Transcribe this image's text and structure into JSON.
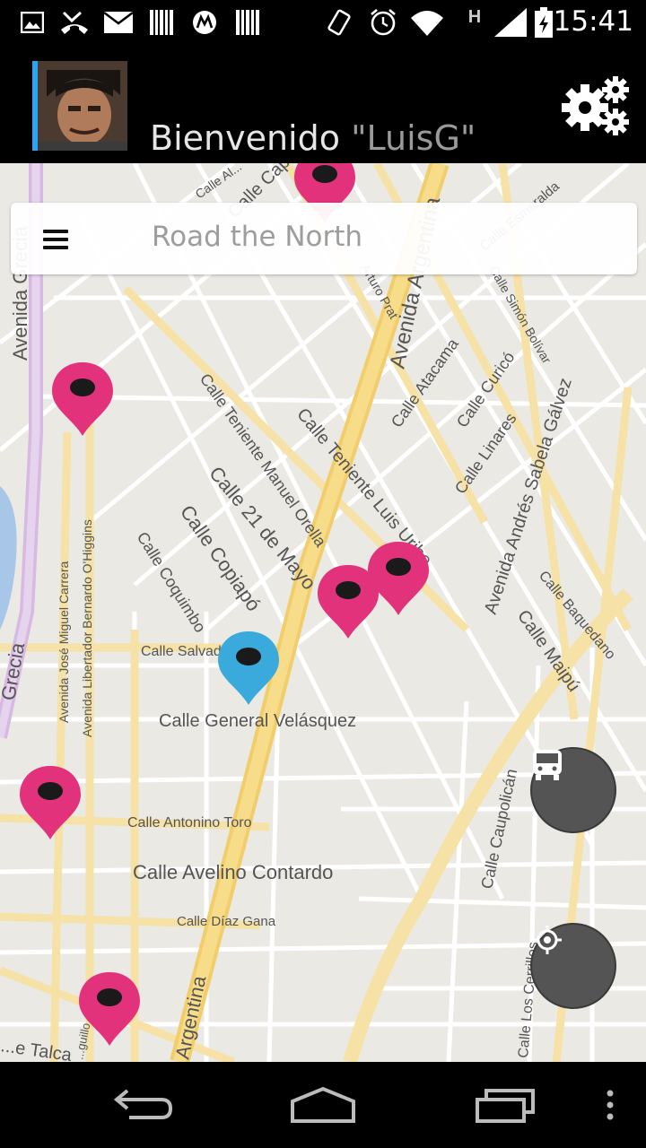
{
  "status_bar": {
    "time": "15:41",
    "network_label": "H",
    "icons": [
      "image-icon",
      "missed-call-icon",
      "mail-icon",
      "barcode-icon",
      "motorola-icon",
      "barcode-icon",
      "vibrate-icon",
      "alarm-icon",
      "wifi-icon",
      "signal-icon",
      "battery-icon"
    ]
  },
  "header": {
    "welcome_prefix": "Bienvenido",
    "username": "\"LuisG\"",
    "settings_icon": "gears-icon",
    "avatar_icon": "user-avatar"
  },
  "search": {
    "menu_icon": "hamburger-menu-icon",
    "placeholder": "Road the North"
  },
  "map": {
    "street_labels": [
      "Avenida Grecia",
      "Grecia",
      "Calle Al...",
      "Calle Capit...",
      "Calle Esmeralda",
      "Arturo Prat",
      "Avenida Argentina",
      "Calle Simón Bolívar",
      "Calle Atacama",
      "Calle Curicó",
      "Calle Teniente Manuel Orella",
      "Calle Teniente Luis Uribe",
      "Calle Linares",
      "Avenida Andrés Sabela Gálvez",
      "Calle 21 de Mayo",
      "Calle Copiapó",
      "Calle Coquimbo",
      "Avenida José Miguel Carrera",
      "Avenida Libertador Bernardo O'Higgins",
      "Calle Salvador...",
      "Calle General Velásquez",
      "Calle Baquedano",
      "Calle Maipú",
      "Calle Antonino Toro",
      "Calle Avelino Contardo",
      "Calle Caupolicán",
      "Calle Díaz Gana",
      "Calle Los Cerrillos",
      "Argentina",
      "...e Talca",
      "...guillo"
    ],
    "pin_color_primary": "#e2327b",
    "pin_color_selected": "#3aa9dc"
  },
  "fabs": {
    "bus_icon": "bus-icon",
    "location_icon": "my-location-icon"
  },
  "nav_bar": {
    "back_icon": "back-icon",
    "home_icon": "home-icon",
    "recents_icon": "recents-icon",
    "overflow_icon": "overflow-menu-icon"
  }
}
